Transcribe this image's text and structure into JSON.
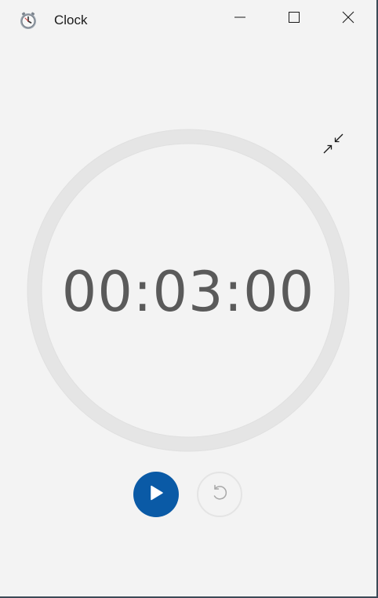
{
  "window": {
    "title": "Clock",
    "app_icon": "alarm-clock-icon",
    "controls": {
      "minimize_icon": "minimize-icon",
      "maximize_icon": "maximize-icon",
      "close_icon": "close-icon"
    }
  },
  "timer": {
    "time": "00:03:00",
    "compact_overlay_icon": "collapse-arrows-icon",
    "play_icon": "play-icon",
    "reset_icon": "reset-icon",
    "play_color": "#0a5aa6"
  }
}
